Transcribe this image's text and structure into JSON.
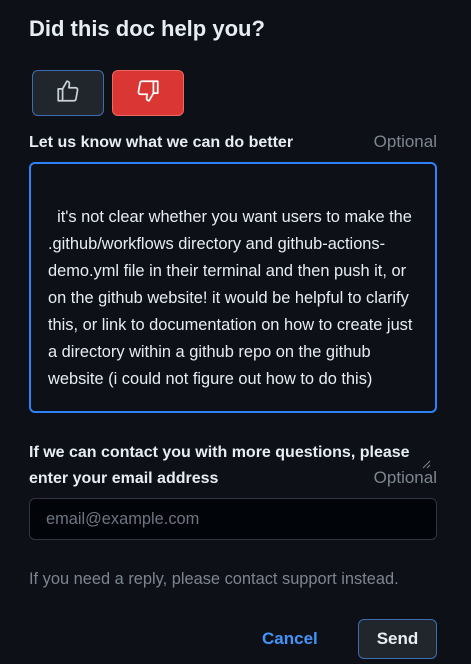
{
  "header": {
    "title": "Did this doc help you?"
  },
  "vote": {
    "up_icon": "thumbs-up-icon",
    "down_icon": "thumbs-down-icon",
    "selected": "down"
  },
  "feedback": {
    "label": "Let us know what we can do better",
    "optional": "Optional",
    "value": "it's not clear whether you want users to make the .github/workflows directory and github-actions-demo.yml file in their terminal and then push it, or on the github website! it would be helpful to clarify this, or link to documentation on how to create just a directory within a github repo on the github website (i could not figure out how to do this)"
  },
  "email": {
    "label_line1": "If we can contact you with more questions, please",
    "label_line2": "enter your email address",
    "optional": "Optional",
    "placeholder": "email@example.com",
    "value": ""
  },
  "helper": {
    "text": "If you need a reply, please contact support instead."
  },
  "actions": {
    "cancel_label": "Cancel",
    "send_label": "Send"
  },
  "colors": {
    "background": "#0d1117",
    "accent_blue": "#2f81f7",
    "danger_red": "#da3633",
    "link_blue": "#4493f8",
    "muted_text": "#7d8590"
  }
}
